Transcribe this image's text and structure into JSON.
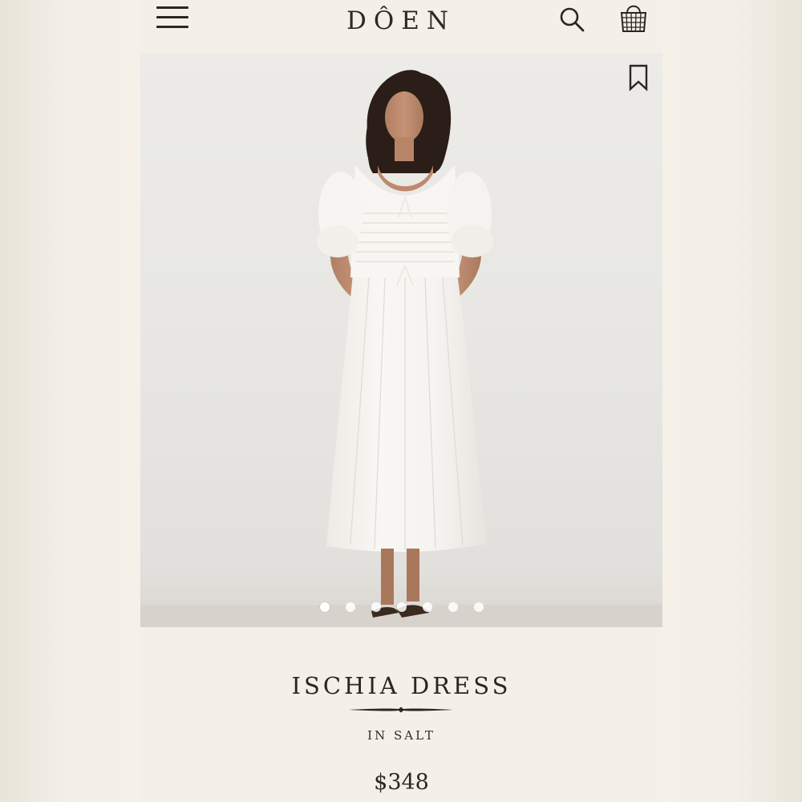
{
  "header": {
    "logo": "DÔEN",
    "menu_icon": "hamburger-menu-icon",
    "search_icon": "search-icon",
    "bag_icon": "shopping-basket-icon"
  },
  "gallery": {
    "bookmark_icon": "bookmark-icon",
    "image_count": 7,
    "active_index": 0
  },
  "product": {
    "name": "ISCHIA DRESS",
    "color": "IN SALT",
    "price": "$348"
  },
  "colors": {
    "text": "#2a2622",
    "page_background": "#f4f0e8",
    "photo_background": "#e8e7e3",
    "dress": "#f6f5f1"
  }
}
